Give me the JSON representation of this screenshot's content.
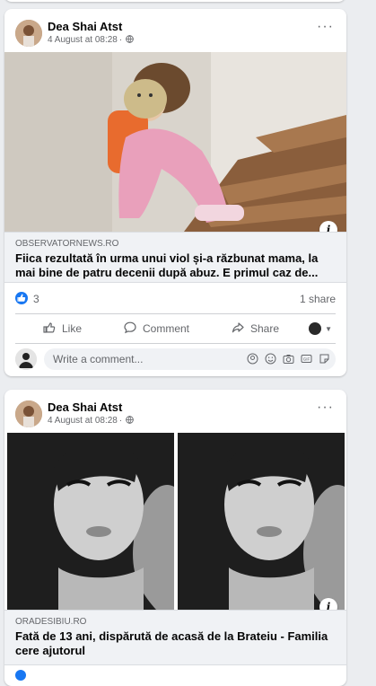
{
  "posts": [
    {
      "author": "Dea Shai Atst",
      "date": "4 August at 08:28",
      "separator": "·",
      "more_icon": "ellipsis-icon",
      "info_label": "i",
      "link": {
        "domain": "OBSERVATORNEWS.RO",
        "title": "Fiica rezultată în urma unui viol și-a răzbunat mama, la mai bine de patru decenii după abuz. E primul caz de..."
      },
      "reactions": {
        "count": "3",
        "shares": "1 share"
      },
      "actions": {
        "like": "Like",
        "comment": "Comment",
        "share": "Share"
      },
      "comment_placeholder": "Write a comment..."
    },
    {
      "author": "Dea Shai Atst",
      "date": "4 August at 08:28",
      "separator": "·",
      "more_icon": "ellipsis-icon",
      "info_label": "i",
      "link": {
        "domain": "ORADESIBIU.RO",
        "title": "Fată de 13 ani, dispărută de acasă de la Brateiu - Familia cere ajutorul"
      }
    }
  ],
  "colors": {
    "accent": "#1877f2",
    "background": "#ebedf0",
    "secondary_text": "#65676b"
  }
}
